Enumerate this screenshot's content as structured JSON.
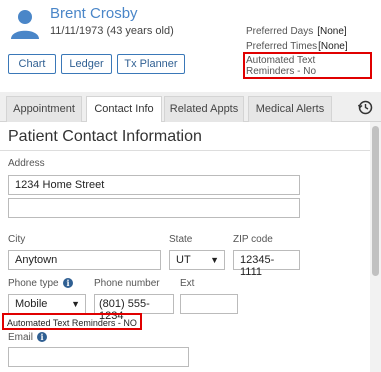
{
  "patient": {
    "name": "Brent Crosby",
    "dob": "11/11/1973 (43 years old)"
  },
  "header_buttons": {
    "chart": "Chart",
    "ledger": "Ledger",
    "tx_planner": "Tx Planner"
  },
  "preferences": {
    "days_label": "Preferred Days",
    "days_value": "[None]",
    "times_label": "Preferred Times",
    "times_value": "[None]",
    "automated_text_reminders": "Automated Text Reminders - No"
  },
  "tabs": [
    {
      "label": "Appointment",
      "active": false
    },
    {
      "label": "Contact Info",
      "active": true
    },
    {
      "label": "Related Appts",
      "active": false
    },
    {
      "label": "Medical Alerts",
      "active": false
    }
  ],
  "contact": {
    "section_title": "Patient Contact Information",
    "address_label": "Address",
    "address1": "1234 Home Street",
    "address2": "",
    "city_label": "City",
    "city": "Anytown",
    "state_label": "State",
    "state": "UT",
    "zip_label": "ZIP code",
    "zip": "12345-1111",
    "phone_type_label": "Phone type",
    "phone_type": "Mobile",
    "phone_number_label": "Phone number",
    "phone_number": "(801) 555-1234",
    "ext_label": "Ext",
    "ext": "",
    "automated_text_reminders": "Automated Text Reminders - NO",
    "email_label": "Email",
    "email": ""
  },
  "icons": {
    "avatar": "user-avatar-icon",
    "history": "history-clock-icon",
    "info": "info-icon"
  },
  "colors": {
    "brand_blue": "#4a86c8",
    "button_border": "#3a78b8",
    "highlight_red": "#e00000"
  }
}
